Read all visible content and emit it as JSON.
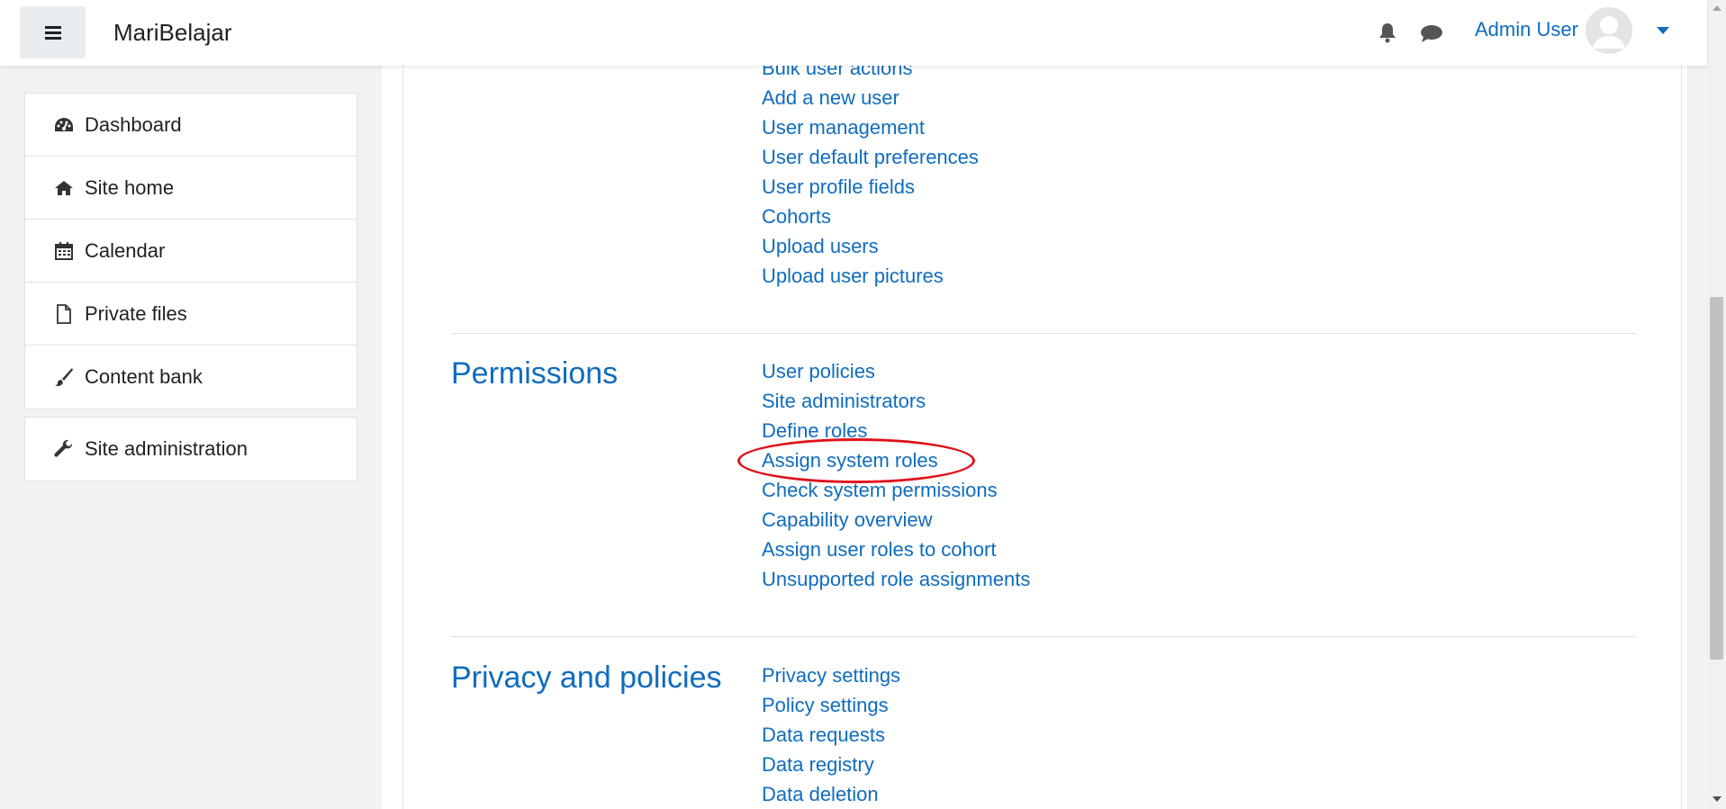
{
  "navbar": {
    "site_name": "MariBelajar",
    "user_name": "Admin User",
    "icons": [
      "menu-icon",
      "bell-icon",
      "chat-icon",
      "avatar",
      "caret-down-icon"
    ]
  },
  "drawer": {
    "items": [
      {
        "label": "Dashboard",
        "icon": "dashboard-icon"
      },
      {
        "label": "Site home",
        "icon": "home-icon"
      },
      {
        "label": "Calendar",
        "icon": "calendar-icon"
      },
      {
        "label": "Private files",
        "icon": "file-icon"
      },
      {
        "label": "Content bank",
        "icon": "paintbrush-icon"
      }
    ],
    "admin_item": {
      "label": "Site administration",
      "icon": "wrench-icon"
    }
  },
  "users_section": {
    "links": [
      "Bulk user actions",
      "Add a new user",
      "User management",
      "User default preferences",
      "User profile fields",
      "Cohorts",
      "Upload users",
      "Upload user pictures"
    ]
  },
  "permissions_section": {
    "title": "Permissions",
    "links": [
      "User policies",
      "Site administrators",
      "Define roles",
      "Assign system roles",
      "Check system permissions",
      "Capability overview",
      "Assign user roles to cohort",
      "Unsupported role assignments"
    ]
  },
  "privacy_section": {
    "title": "Privacy and policies",
    "links": [
      "Privacy settings",
      "Policy settings",
      "Data requests",
      "Data registry",
      "Data deletion"
    ]
  },
  "colors": {
    "link": "#0f6cbf",
    "highlight": "#e0121b"
  }
}
